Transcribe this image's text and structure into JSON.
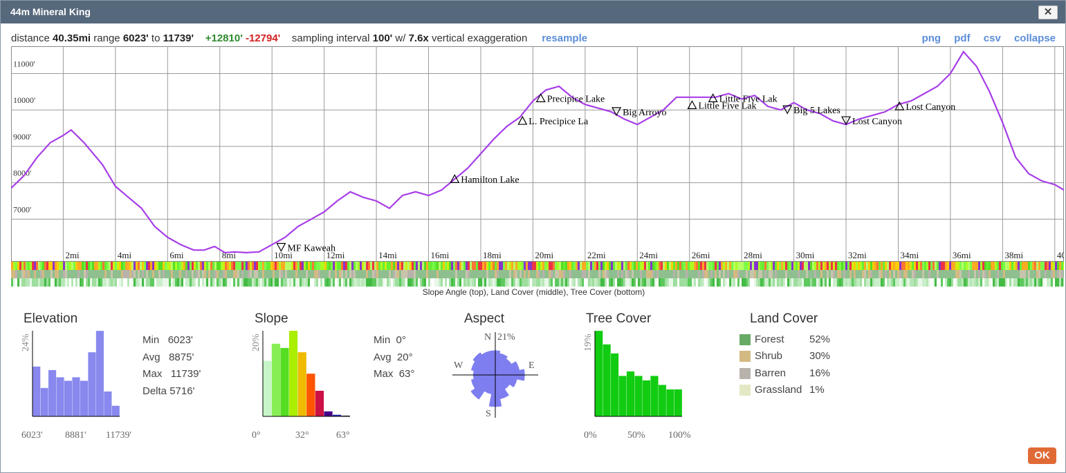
{
  "window": {
    "title": "44m Mineral King",
    "close_label": "✕"
  },
  "summary": {
    "distance_label": "distance",
    "distance": "40.35mi",
    "range_label": "range",
    "range_min": "6023'",
    "range_to": "to",
    "range_max": "11739'",
    "gain": "+12810'",
    "loss": "-12794'",
    "sampling_label": "sampling interval",
    "sampling": "100'",
    "wslash": "w/",
    "exaggeration": "7.6x",
    "exaggeration_label": "vertical exaggeration",
    "resample": "resample"
  },
  "links": {
    "png": "png",
    "pdf": "pdf",
    "csv": "csv",
    "collapse": "collapse"
  },
  "chart_data": {
    "type": "line",
    "xlabel": "",
    "ylabel": "",
    "xlim": [
      0,
      40.35
    ],
    "ylim": [
      5850,
      11750
    ],
    "x_ticks": [
      "2mi",
      "4mi",
      "6mi",
      "8mi",
      "10mi",
      "12mi",
      "14mi",
      "16mi",
      "18mi",
      "20mi",
      "22mi",
      "24mi",
      "26mi",
      "28mi",
      "30mi",
      "32mi",
      "34mi",
      "36mi",
      "38mi",
      "40"
    ],
    "x_tick_values": [
      2,
      4,
      6,
      8,
      10,
      12,
      14,
      16,
      18,
      20,
      22,
      24,
      26,
      28,
      30,
      32,
      34,
      36,
      38,
      40
    ],
    "y_ticks": [
      "7000'",
      "8000'",
      "9000'",
      "10000'",
      "11000'"
    ],
    "y_tick_values": [
      7000,
      8000,
      9000,
      10000,
      11000
    ],
    "grid": true,
    "line_color": "#a73ee8",
    "series": [
      {
        "x": [
          0,
          0.5,
          1.0,
          1.5,
          2.0,
          2.3,
          2.8,
          3.5,
          4.0,
          4.5,
          5.0,
          5.5,
          6.0,
          6.5,
          7.0,
          7.4,
          7.8,
          8.2,
          8.6,
          9.0,
          9.5,
          10.0,
          10.5,
          11.0,
          11.5,
          12.0,
          12.5,
          13.0,
          13.5,
          14.0,
          14.5,
          15.0,
          15.5,
          16.0,
          16.5,
          17.0,
          17.5,
          18.0,
          18.5,
          19.0,
          19.5,
          20.0,
          20.5,
          21.0,
          21.5,
          22.0,
          22.5,
          23.0,
          23.5,
          24.0,
          24.5,
          25.0,
          25.5,
          26.0,
          26.5,
          27.0,
          27.5,
          28.0,
          28.5,
          29.0,
          29.5,
          30.0,
          30.5,
          31.0,
          31.5,
          32.0,
          32.5,
          33.0,
          33.5,
          34.0,
          34.5,
          35.0,
          35.5,
          36.0,
          36.5,
          37.0,
          37.5,
          38.0,
          38.5,
          39.0,
          39.5,
          40.0,
          40.35
        ],
        "y": [
          7850,
          8200,
          8700,
          9100,
          9300,
          9450,
          9100,
          8500,
          7900,
          7600,
          7300,
          6800,
          6500,
          6300,
          6150,
          6150,
          6250,
          6080,
          6100,
          6080,
          6100,
          6300,
          6500,
          6800,
          7000,
          7200,
          7500,
          7750,
          7600,
          7500,
          7300,
          7650,
          7750,
          7650,
          7800,
          8100,
          8400,
          8800,
          9200,
          9550,
          9800,
          10250,
          10550,
          10650,
          10350,
          10150,
          10050,
          9950,
          9750,
          9600,
          9800,
          10000,
          10350,
          10350,
          10350,
          10350,
          10450,
          10300,
          10400,
          10100,
          10000,
          10200,
          10000,
          9900,
          9700,
          9600,
          9750,
          9850,
          9950,
          10150,
          10250,
          10450,
          10650,
          11000,
          11600,
          11200,
          10500,
          9650,
          8700,
          8250,
          8050,
          7950,
          7800
        ]
      }
    ],
    "waypoints": [
      {
        "label": "MF Kaweah",
        "x": 10.35,
        "y": 6220,
        "dir": "down"
      },
      {
        "label": "Hamilton Lake",
        "x": 17.0,
        "y": 8100,
        "dir": "up"
      },
      {
        "label": "L. Precipice La",
        "x": 19.6,
        "y": 9700,
        "dir": "up"
      },
      {
        "label": "Precipice Lake",
        "x": 20.3,
        "y": 10320,
        "dir": "up"
      },
      {
        "label": "Big Arroyo",
        "x": 23.2,
        "y": 9950,
        "dir": "down"
      },
      {
        "label": "Little Five Lak",
        "x": 26.9,
        "y": 10320,
        "dir": "up"
      },
      {
        "label": "Little Five Lak",
        "x": 26.1,
        "y": 10130,
        "dir": "up"
      },
      {
        "label": "Big 5 Lakes",
        "x": 29.75,
        "y": 10000,
        "dir": "down"
      },
      {
        "label": "Lost Canyon",
        "x": 32.0,
        "y": 9700,
        "dir": "down"
      },
      {
        "label": "Lost Canyon",
        "x": 34.05,
        "y": 10100,
        "dir": "up"
      }
    ]
  },
  "band_caption": "Slope Angle (top), Land Cover (middle), Tree Cover (bottom)",
  "elevation": {
    "title": "Elevation",
    "ymax_label": "24%",
    "bins": [
      14,
      8,
      13,
      11,
      10,
      11,
      10,
      18,
      24,
      7,
      3
    ],
    "x_labels": [
      "6023'",
      "8881'",
      "11739'"
    ],
    "stats": [
      {
        "k": "Min",
        "v": "6023'"
      },
      {
        "k": "Avg",
        "v": "8875'"
      },
      {
        "k": "Max",
        "v": "11739'"
      },
      {
        "k": "Delta",
        "v": "5716'"
      }
    ],
    "bar_color": "#8888ee"
  },
  "slope": {
    "title": "Slope",
    "ymax_label": "20%",
    "bins": [
      13,
      17,
      16,
      20,
      15,
      10,
      6,
      1.2,
      0.4,
      0.2
    ],
    "colors": [
      "#c7f5c7",
      "#88ee55",
      "#55dd22",
      "#aaee00",
      "#eebb00",
      "#ff5500",
      "#cc1144",
      "#440088",
      "#2222aa",
      "#222222"
    ],
    "x_labels": [
      "0°",
      "32°",
      "63°"
    ],
    "stats": [
      {
        "k": "Min",
        "v": "0°"
      },
      {
        "k": "Avg",
        "v": "20°"
      },
      {
        "k": "Max",
        "v": "63°"
      }
    ]
  },
  "aspect": {
    "title": "Aspect",
    "max_label": "21%",
    "dirs": [
      "N",
      "E",
      "S",
      "W"
    ],
    "petals": [
      10,
      9,
      8,
      10,
      12,
      9,
      7,
      10,
      13,
      8,
      12,
      10,
      9,
      10,
      11,
      10
    ],
    "color": "#7e7ef0"
  },
  "tree_cover": {
    "title": "Tree Cover",
    "ymax_label": "19%",
    "bins": [
      19,
      16,
      14,
      9,
      10,
      9,
      8,
      9,
      7,
      6,
      6
    ],
    "x_labels": [
      "0%",
      "50%",
      "100%"
    ],
    "bar_color": "#11cc11"
  },
  "land_cover": {
    "title": "Land Cover",
    "items": [
      {
        "name": "Forest",
        "pct": "52%",
        "color": "#66aa66"
      },
      {
        "name": "Shrub",
        "pct": "30%",
        "color": "#d2ba82"
      },
      {
        "name": "Barren",
        "pct": "16%",
        "color": "#b8b2ac"
      },
      {
        "name": "Grassland",
        "pct": "1%",
        "color": "#e4e8c4"
      }
    ]
  },
  "ok_label": "OK"
}
